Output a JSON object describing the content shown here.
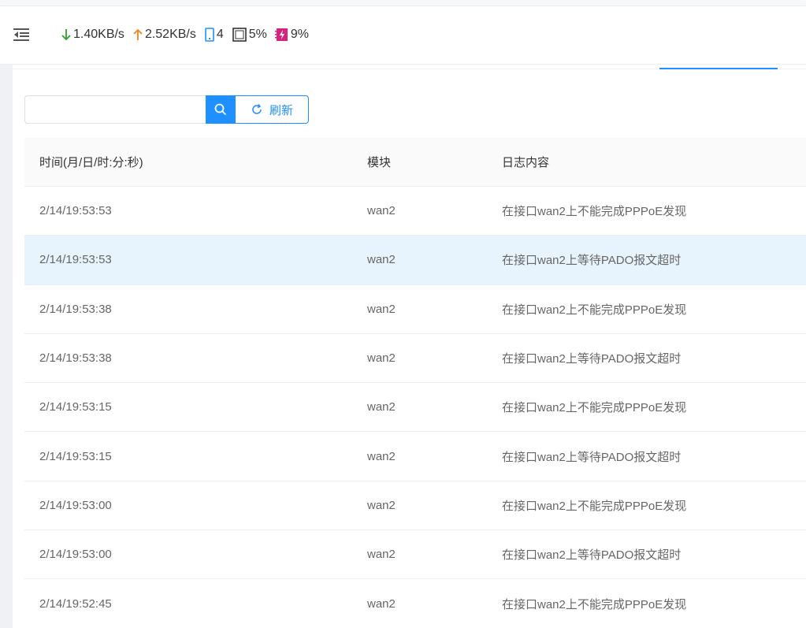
{
  "header": {
    "download_speed": "1.40KB/s",
    "upload_speed": "2.52KB/s",
    "devices": "4",
    "cpu": "5%",
    "memory": "9%",
    "colors": {
      "download": "#2aa52a",
      "upload": "#f0851f",
      "device": "#1e90ff",
      "memory": "#d6237e"
    }
  },
  "toolbar": {
    "search_placeholder": "",
    "refresh_label": "刷新"
  },
  "table": {
    "columns": [
      "时间(月/日/时:分:秒)",
      "模块",
      "日志内容"
    ],
    "rows": [
      {
        "time": "2/14/19:53:53",
        "module": "wan2",
        "content": "在接口wan2上不能完成PPPoE发现"
      },
      {
        "time": "2/14/19:53:53",
        "module": "wan2",
        "content": "在接口wan2上等待PADO报文超时"
      },
      {
        "time": "2/14/19:53:38",
        "module": "wan2",
        "content": "在接口wan2上不能完成PPPoE发现"
      },
      {
        "time": "2/14/19:53:38",
        "module": "wan2",
        "content": "在接口wan2上等待PADO报文超时"
      },
      {
        "time": "2/14/19:53:15",
        "module": "wan2",
        "content": "在接口wan2上不能完成PPPoE发现"
      },
      {
        "time": "2/14/19:53:15",
        "module": "wan2",
        "content": "在接口wan2上等待PADO报文超时"
      },
      {
        "time": "2/14/19:53:00",
        "module": "wan2",
        "content": "在接口wan2上不能完成PPPoE发现"
      },
      {
        "time": "2/14/19:53:00",
        "module": "wan2",
        "content": "在接口wan2上等待PADO报文超时"
      },
      {
        "time": "2/14/19:52:45",
        "module": "wan2",
        "content": "在接口wan2上不能完成PPPoE发现"
      }
    ]
  }
}
